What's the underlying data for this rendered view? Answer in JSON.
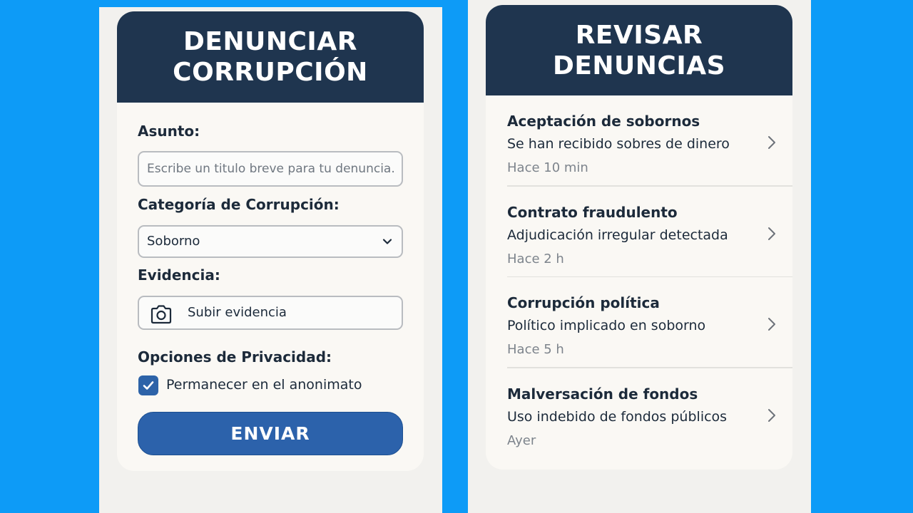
{
  "report": {
    "title_line1": "DENUNCIAR",
    "title_line2": "CORRUPCIÓN",
    "subject_label": "Asunto:",
    "subject_placeholder": "Escribe un titulo breve para tu denuncia.",
    "subject_value": "",
    "category_label": "Categoría de Corrupción:",
    "category_selected": "Soborno",
    "evidence_label": "Evidencia:",
    "evidence_button": "Subir evidencia",
    "evidence_icon": "camera-icon",
    "privacy_label": "Opciones de Privacidad:",
    "anonymous_label": "Permanecer en el anonimato",
    "anonymous_checked": true,
    "submit_label": "ENVIAR"
  },
  "review": {
    "title_line1": "REVISAR",
    "title_line2": "DENUNCIAS",
    "items": [
      {
        "title": "Aceptación de sobornos",
        "description": "Se han recibido sobres de dinero",
        "time": "Hace 10 min"
      },
      {
        "title": "Contrato fraudulento",
        "description": "Adjudicación irregular detectada",
        "time": "Hace 2 h"
      },
      {
        "title": "Corrupción política",
        "description": "Político implicado en soborno",
        "time": "Hace 5 h"
      },
      {
        "title": "Malversación de fondos",
        "description": "Uso indebido de fondos públicos",
        "time": "Ayer"
      }
    ]
  },
  "colors": {
    "background": "#0d9bf7",
    "header": "#1f354f",
    "primary": "#2c62ab",
    "card": "#faf8f4"
  }
}
